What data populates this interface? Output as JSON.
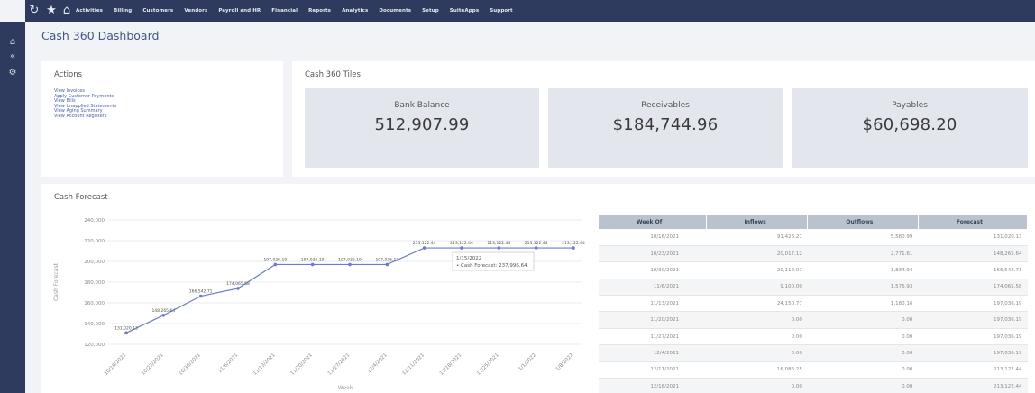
{
  "nav": {
    "menu": [
      "Activities",
      "Billing",
      "Customers",
      "Vendors",
      "Payroll and HR",
      "Financial",
      "Reports",
      "Analytics",
      "Documents",
      "Setup",
      "SuiteApps",
      "Support"
    ]
  },
  "page_title": "Cash 360 Dashboard",
  "actions": {
    "title": "Actions",
    "links": [
      "View Invoices",
      "Apply Customer Payments",
      "View Bills",
      "View Unapplied Statements",
      "View Aging Summary",
      "View Account Registers"
    ]
  },
  "tiles": {
    "title": "Cash 360 Tiles",
    "items": [
      {
        "label": "Bank Balance",
        "value": "512,907.99"
      },
      {
        "label": "Receivables",
        "value": "$184,744.96"
      },
      {
        "label": "Payables",
        "value": "$60,698.20"
      }
    ]
  },
  "forecast": {
    "title": "Cash Forecast",
    "tooltip": {
      "line1": "1/15/2022",
      "line2": "• Cash Forecast: 237,996.64"
    },
    "chart_data": {
      "type": "line",
      "ylabel": "Cash Forecast",
      "xlabel": "Week",
      "ylim": [
        120000,
        240000
      ],
      "y_ticks": [
        "240,000",
        "220,000",
        "200,000",
        "180,000",
        "160,000",
        "140,000",
        "120,000"
      ],
      "x": [
        "10/16/2021",
        "10/23/2021",
        "10/30/2021",
        "11/6/2021",
        "11/13/2021",
        "11/20/2021",
        "11/27/2021",
        "12/4/2021",
        "12/11/2021",
        "12/18/2021",
        "12/25/2021",
        "1/1/2022",
        "1/8/2022"
      ],
      "series": [
        {
          "values": [
            131000,
            148000,
            166500,
            174000,
            197000,
            197000,
            197000,
            197000,
            213000,
            213000,
            213000,
            213000,
            213000
          ],
          "labels": [
            "131,020.13",
            "148,265.64",
            "166,542.71",
            "174,065.58",
            "197,036.19",
            "197,036.19",
            "197,036.19",
            "197,036.19",
            "213,122.44",
            "213,122.44",
            "213,122.44",
            "213,122.44",
            "213,122.44"
          ]
        }
      ],
      "grid": true
    }
  },
  "table": {
    "headers": [
      "Week Of",
      "Inflows",
      "Outflows",
      "Forecast"
    ],
    "rows": [
      [
        "10/16/2021",
        "91,426.21",
        "5,580.99",
        "131,020.13"
      ],
      [
        "10/23/2021",
        "20,017.12",
        "2,771.61",
        "148,265.64"
      ],
      [
        "10/30/2021",
        "20,112.01",
        "1,834.94",
        "166,542.71"
      ],
      [
        "11/6/2021",
        "9,100.00",
        "1,576.93",
        "174,065.58"
      ],
      [
        "11/13/2021",
        "24,150.77",
        "1,180.16",
        "197,036.19"
      ],
      [
        "11/20/2021",
        "0.00",
        "0.00",
        "197,036.19"
      ],
      [
        "11/27/2021",
        "0.00",
        "0.00",
        "197,036.19"
      ],
      [
        "12/4/2021",
        "0.00",
        "0.00",
        "197,036.19"
      ],
      [
        "12/11/2021",
        "16,086.25",
        "0.00",
        "213,122.44"
      ],
      [
        "12/18/2021",
        "0.00",
        "0.00",
        "213,122.44"
      ]
    ]
  }
}
